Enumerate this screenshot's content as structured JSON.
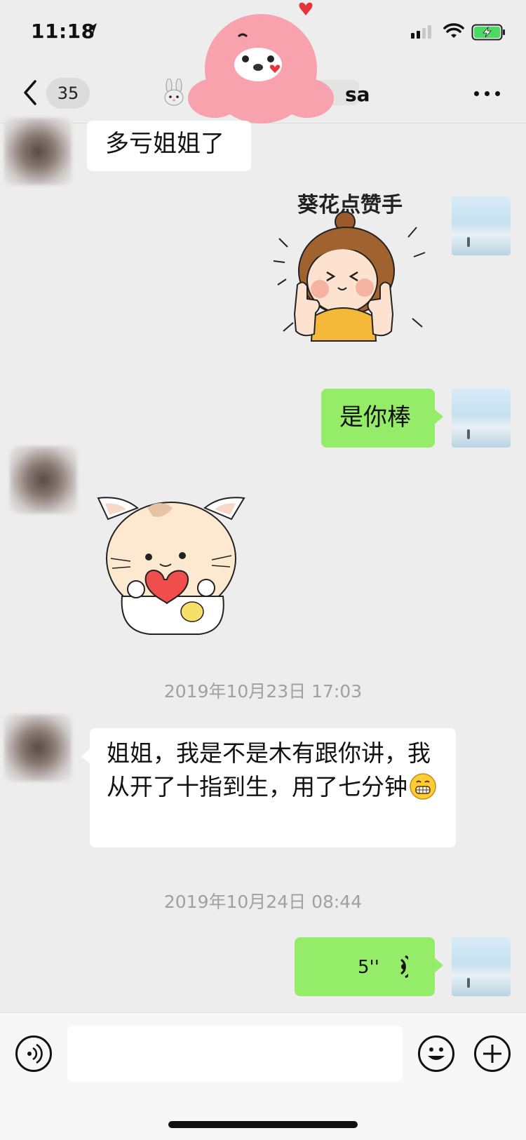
{
  "status_bar": {
    "time": "11:18"
  },
  "nav": {
    "unread_count": "35",
    "title_suffix": "sa"
  },
  "messages": [
    {
      "from": "other",
      "type": "text",
      "text": "多亏姐姐了"
    },
    {
      "from": "self",
      "type": "sticker",
      "caption": "葵花点赞手"
    },
    {
      "from": "self",
      "type": "text",
      "text": "是你棒"
    },
    {
      "from": "other",
      "type": "sticker"
    },
    {
      "type": "timestamp",
      "text": "2019年10月23日 17:03"
    },
    {
      "from": "other",
      "type": "text",
      "text": "姐姐，我是不是木有跟你讲，我从开了十指到生，用了七分钟"
    },
    {
      "type": "timestamp",
      "text": "2019年10月24日 08:44"
    },
    {
      "from": "self",
      "type": "voice",
      "duration": "5''"
    }
  ],
  "colors": {
    "background": "#ededed",
    "self_bubble": "#95ec69",
    "other_bubble": "#ffffff",
    "timestamp": "#a0a0a0"
  },
  "icons": {
    "voice_input": "voice-input-icon",
    "emoji": "emoji-icon",
    "add": "plus-icon",
    "more": "more-icon",
    "back": "back-chevron-icon"
  }
}
